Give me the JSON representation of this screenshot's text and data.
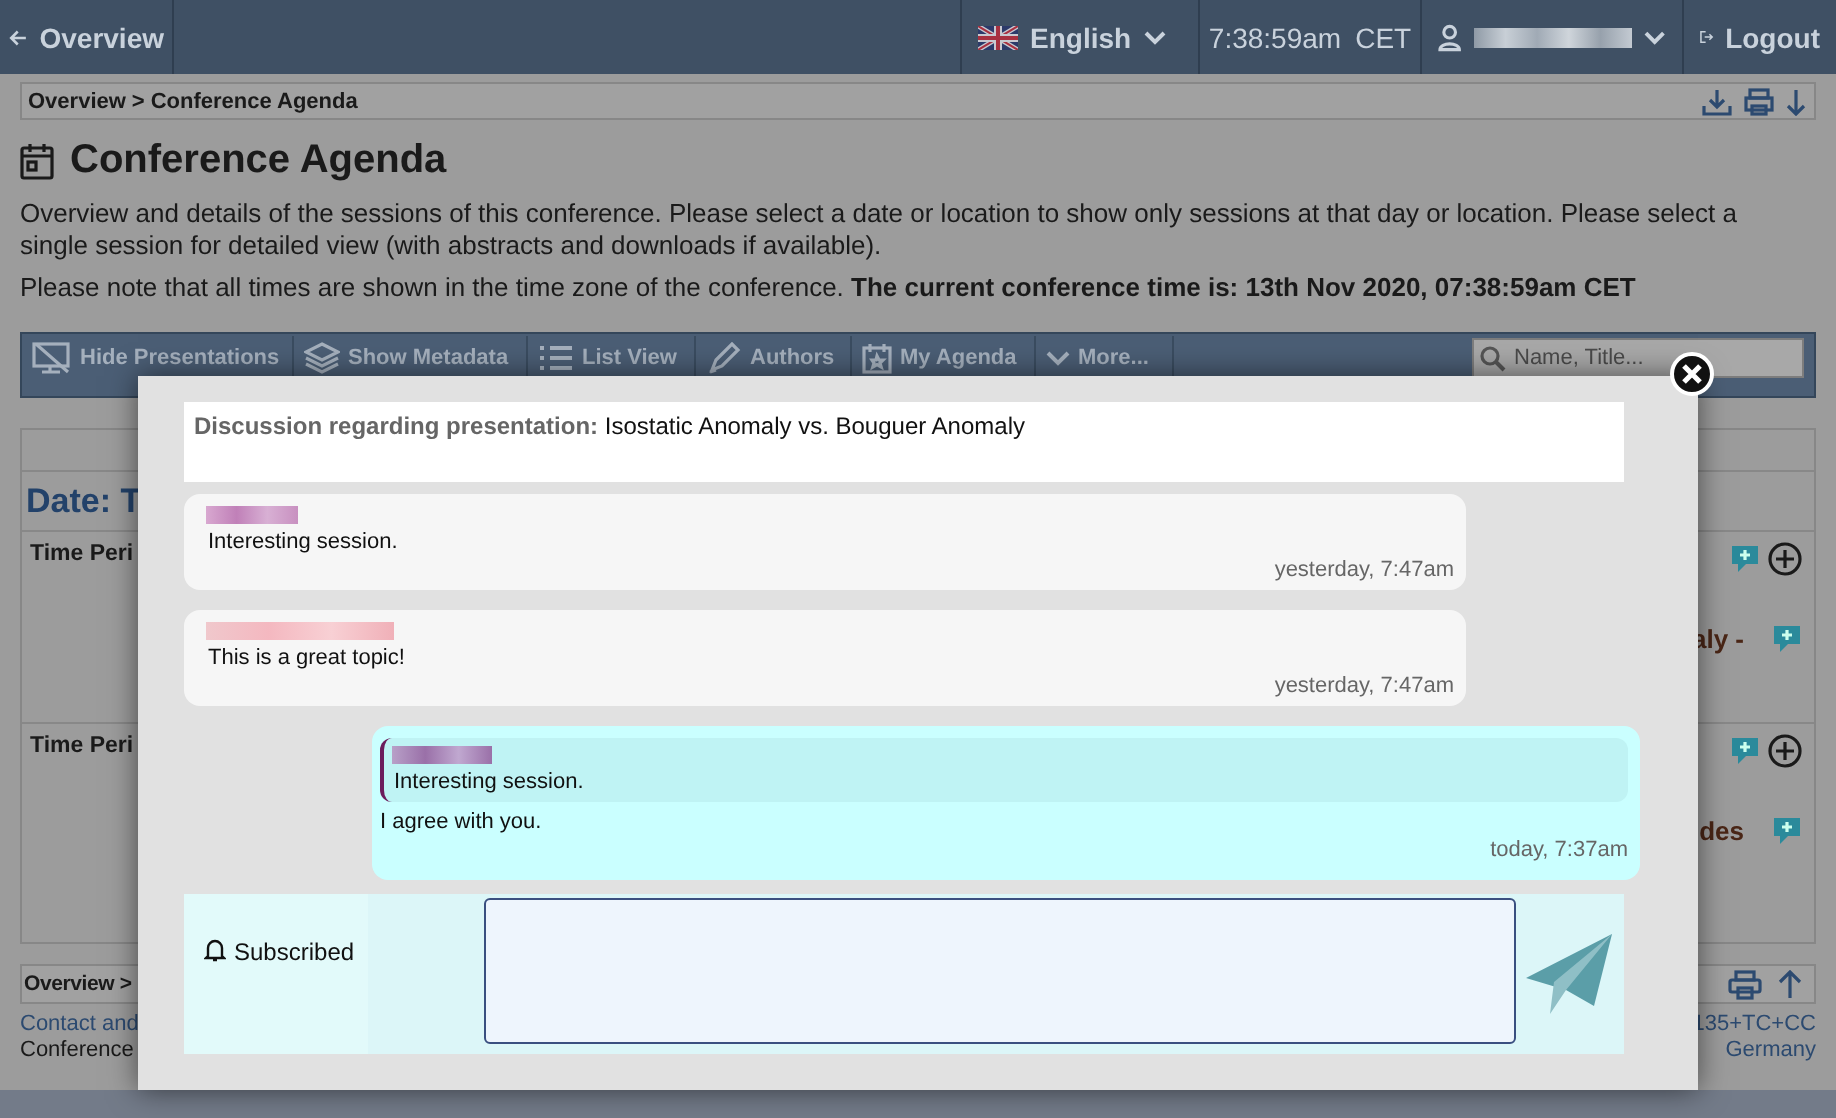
{
  "topbar": {
    "back": "Overview",
    "language": "English",
    "time": "7:38:59am",
    "timezone": "CET",
    "logout": "Logout"
  },
  "breadcrumb": {
    "items": [
      "Overview",
      "Conference Agenda"
    ],
    "separator": ">"
  },
  "page": {
    "title": "Conference Agenda",
    "description": "Overview and details of the sessions of this conference. Please select a date or location to show only sessions at that day or location. Please select a single session for detailed view (with abstracts and downloads if available).",
    "note": "Please note that all times are shown in the time zone of the conference. **The current conference time is: 13th Nov 2020, 07:38:59am CET**"
  },
  "toolbar": {
    "buttons": [
      "Hide Presentations",
      "Show Metadata",
      "List View",
      "Authors",
      "My Agenda",
      "More..."
    ],
    "search": {
      "placeholder": "Name, Title..."
    }
  },
  "agenda": {
    "date_heading": "Date: T",
    "rows": [
      {
        "period": "Time Peri",
        "fragment": "aly -"
      },
      {
        "period": "Time Peri",
        "fragment": "des"
      }
    ]
  },
  "footer": {
    "breadcrumb": "Overview >",
    "left_lines": [
      "Contact and",
      "Conference"
    ],
    "right_lines": [
      "135+TC+CC",
      "Germany"
    ]
  },
  "dialog": {
    "heading_label": "Discussion regarding presentation:",
    "heading_title": "Isostatic Anomaly vs. Bouguer Anomaly",
    "messages": [
      {
        "own": false,
        "text": "Interesting session.",
        "time": "yesterday, 7:47am"
      },
      {
        "own": false,
        "text": "This is a great topic!",
        "time": "yesterday, 7:47am"
      },
      {
        "own": true,
        "quote": "Interesting session.",
        "text": "I agree with you.",
        "time": "today, 7:37am"
      }
    ],
    "subscribed": "Subscribed"
  }
}
